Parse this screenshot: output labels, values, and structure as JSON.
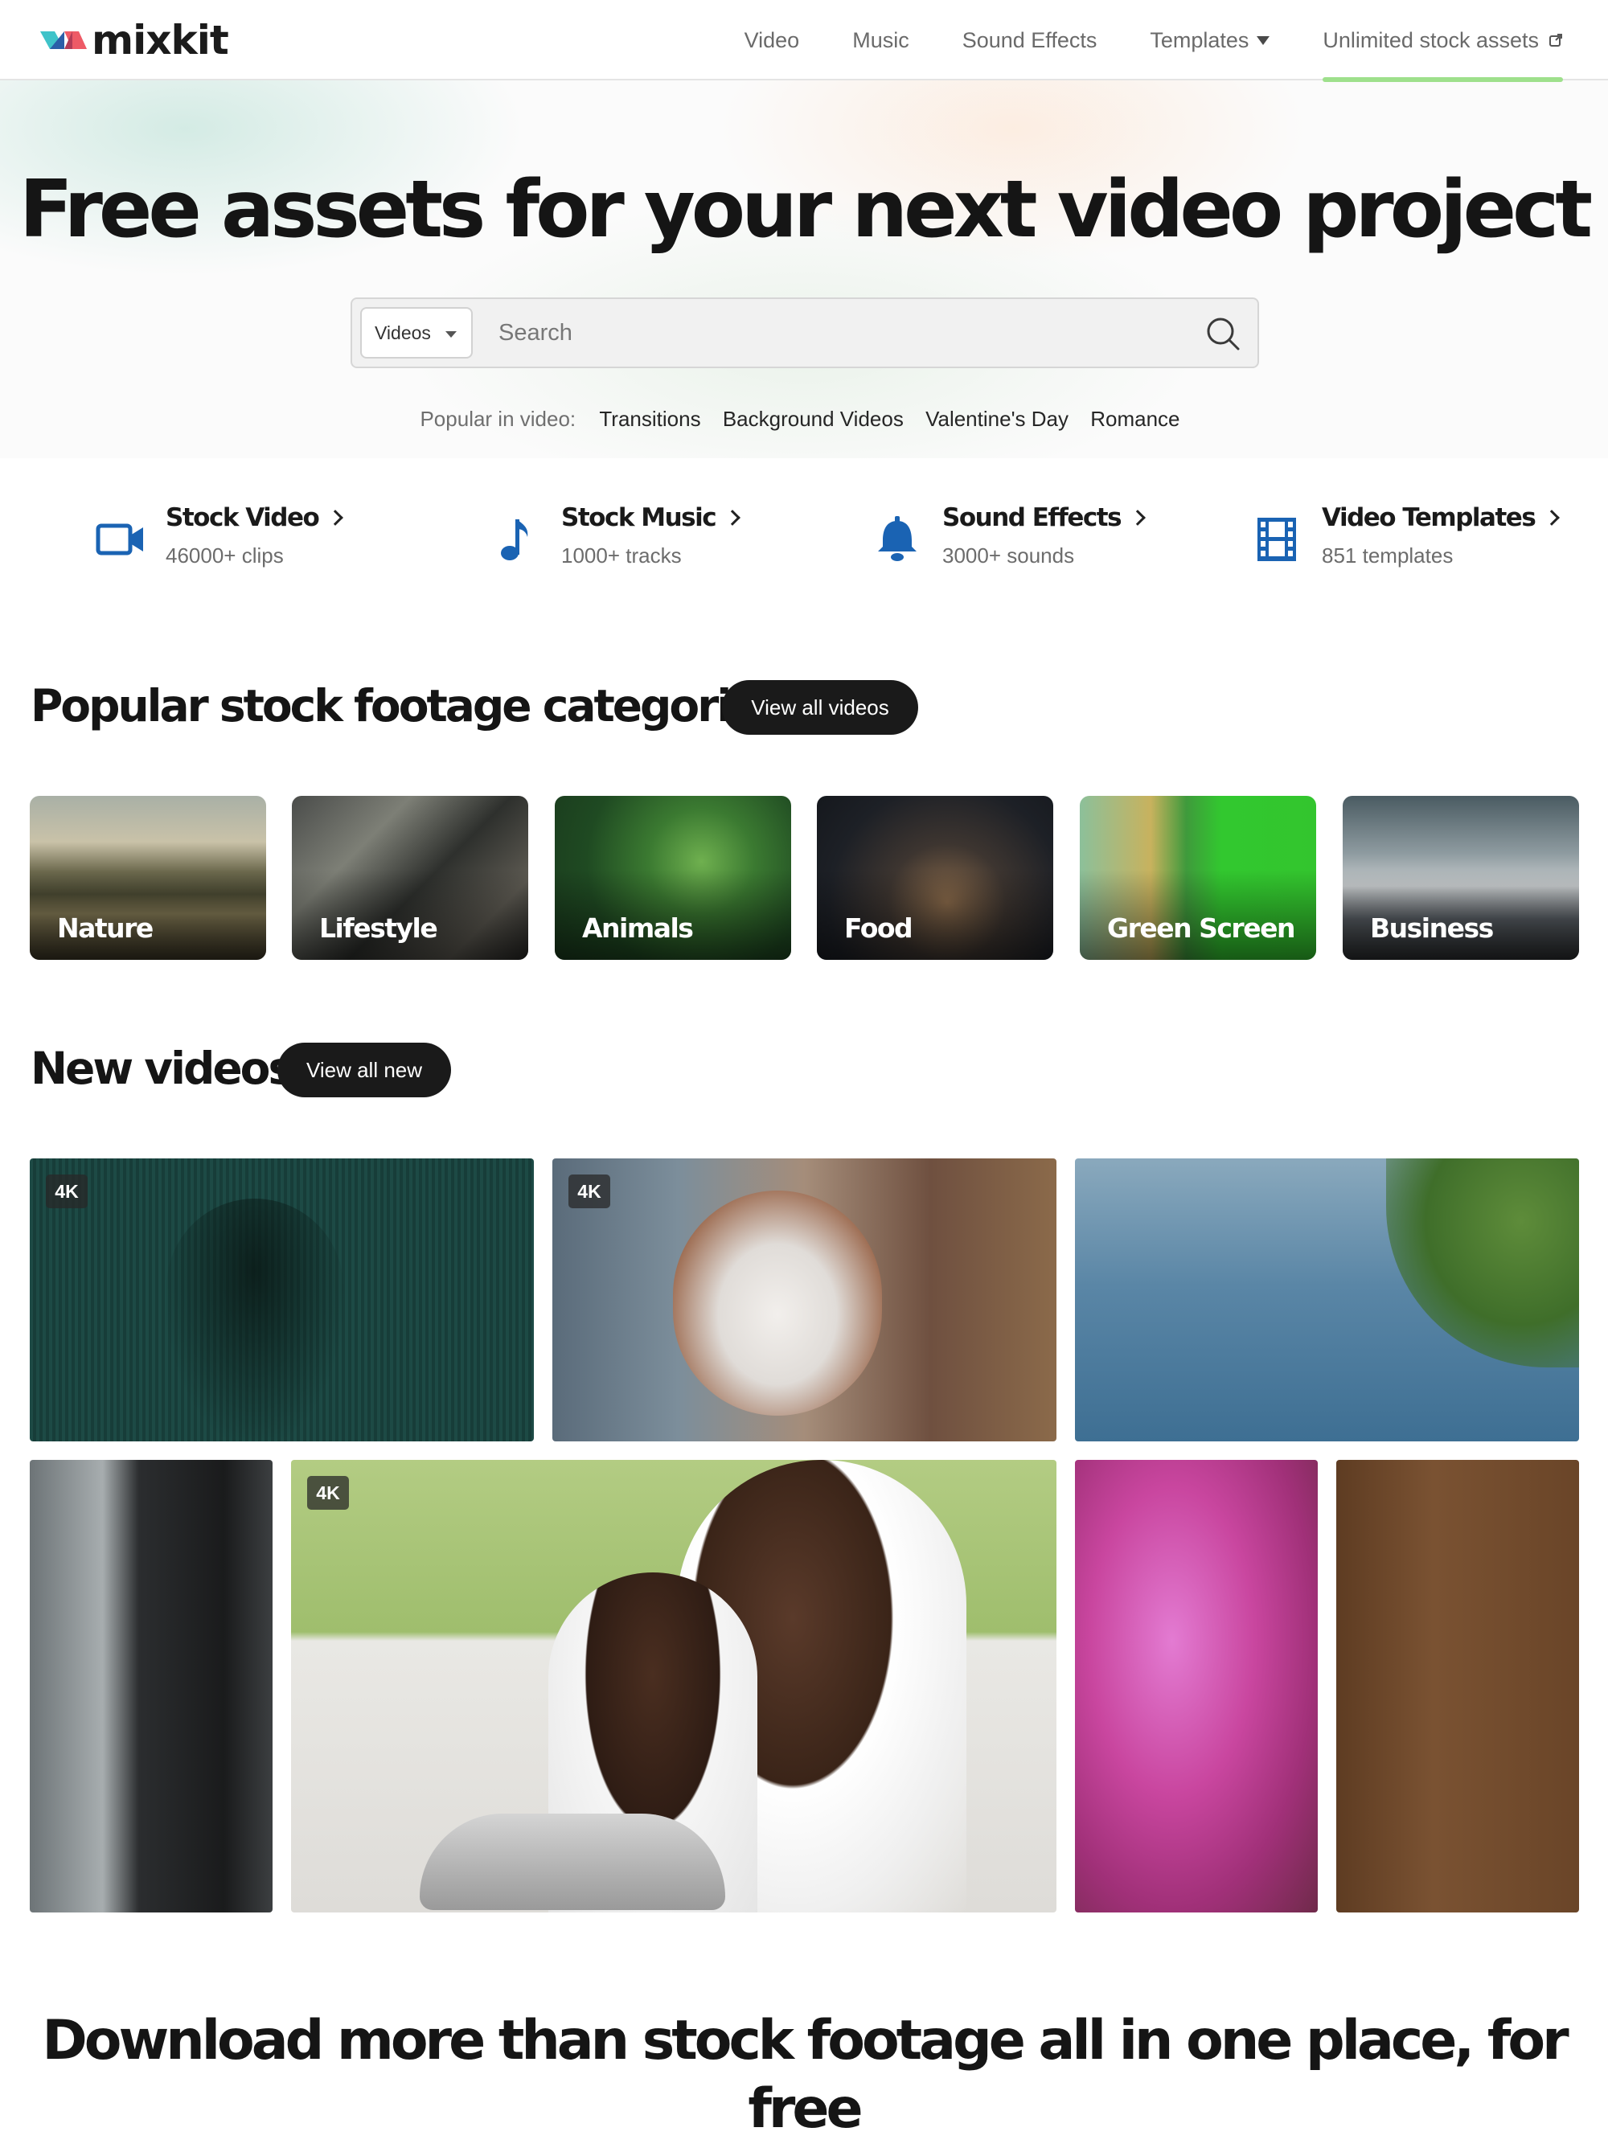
{
  "header": {
    "logo_text": "mixkit",
    "nav": {
      "video": "Video",
      "music": "Music",
      "sound_effects": "Sound Effects",
      "templates": "Templates",
      "unlimited": "Unlimited stock assets"
    }
  },
  "hero": {
    "title": "Free assets for your next video project",
    "search": {
      "category": "Videos",
      "placeholder": "Search"
    },
    "popular": {
      "label": "Popular in video:",
      "links": [
        "Transitions",
        "Background Videos",
        "Valentine's Day",
        "Romance"
      ]
    }
  },
  "categories": [
    {
      "title": "Stock Video",
      "subtitle": "46000+ clips",
      "icon": "video-camera-icon"
    },
    {
      "title": "Stock Music",
      "subtitle": "1000+ tracks",
      "icon": "music-note-icon"
    },
    {
      "title": "Sound Effects",
      "subtitle": "3000+ sounds",
      "icon": "bell-icon"
    },
    {
      "title": "Video Templates",
      "subtitle": "851 templates",
      "icon": "film-icon"
    }
  ],
  "popular_categories": {
    "title": "Popular stock footage categories",
    "button": "View all videos",
    "tiles": [
      "Nature",
      "Lifestyle",
      "Animals",
      "Food",
      "Green Screen",
      "Business"
    ]
  },
  "new_videos": {
    "title": "New videos",
    "button": "View all new",
    "badges": [
      "4K",
      "4K",
      "4K"
    ]
  },
  "bottom": {
    "title_line1": "Download more than stock footage all in one place, for",
    "title_line2": "free"
  },
  "colors": {
    "accent_blue": "#1a63b3",
    "nav_underline": "#9ee08c",
    "dark_button": "#1a1a1a"
  }
}
